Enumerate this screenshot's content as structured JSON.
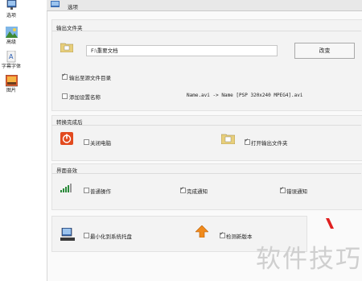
{
  "sidebar": {
    "items": [
      {
        "label": "选项",
        "icon": "monitor-icon"
      },
      {
        "label": "高级",
        "icon": "landscape-icon"
      },
      {
        "label": "字幕字体",
        "icon": "font-document-icon"
      },
      {
        "label": "图片",
        "icon": "picture-icon"
      }
    ]
  },
  "topbar": {
    "title": "选项",
    "icon": "options-icon"
  },
  "output_folder": {
    "title": "输出文件夹",
    "path_value": "F:\\重要文档",
    "change_button": "改变",
    "output_to_source_label": "输出至源文件目录",
    "output_to_source_checked": true,
    "add_setting_name_label": "添加设置名称",
    "add_setting_name_checked": false,
    "rename_example": "Name.avi  -> Name [PSP 320x240 MPEG4].avi"
  },
  "after_conversion": {
    "title": "转换完成后",
    "shutdown_label": "关闭电脑",
    "shutdown_checked": false,
    "open_output_label": "打开输出文件夹",
    "open_output_checked": true
  },
  "ui_effects": {
    "title": "界面音效",
    "normal_op_label": "普通操作",
    "normal_op_checked": false,
    "complete_label": "完成通知",
    "complete_checked": true,
    "error_label": "错误通知",
    "error_checked": true
  },
  "misc": {
    "minimize_tray_label": "最小化到系统托盘",
    "minimize_tray_checked": false,
    "check_update_label": "检测新版本",
    "check_update_checked": true
  },
  "watermark": "软件技巧",
  "colors": {
    "accent_red": "#e24a1f",
    "watermark": "#cfcfcf"
  }
}
